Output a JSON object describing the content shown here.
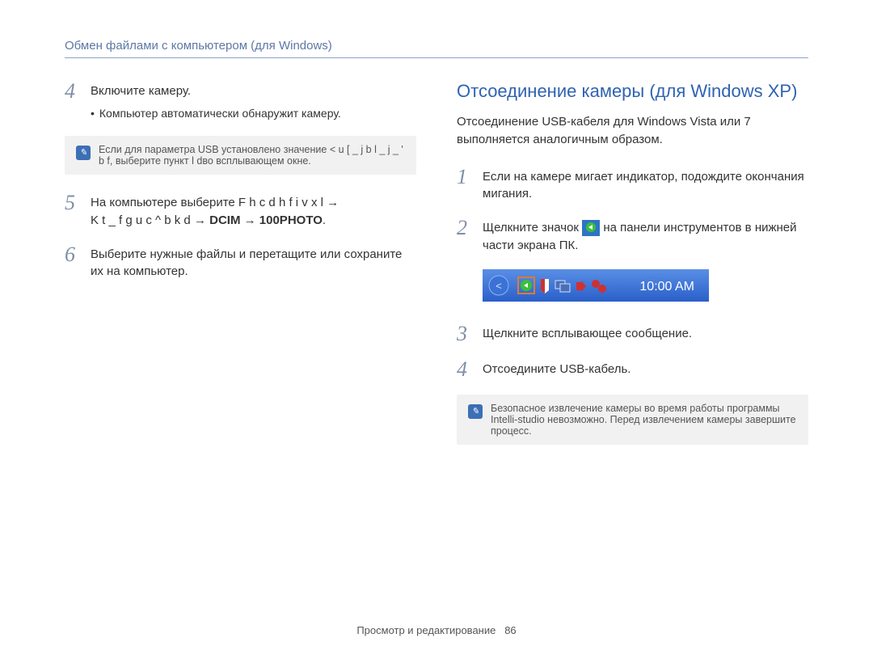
{
  "breadcrumb": "Обмен файлами с компьютером (для Windows)",
  "left": {
    "step4_title": "Включите камеру.",
    "step4_sub": "Компьютер автоматически обнаружит камеру.",
    "note1": "Если для параметра USB установлено значение  < u [ _ j b l _ j _ ' b f, выберите пункт  l dво всплывающем окне.",
    "step5_prefix": "На компьютере выберите  F h c  d h f i v x l  ",
    "step5_line2": "K t _ f g u c ^ b k d",
    "step5_arrow": " → ",
    "step5_b1": "DCIM",
    "step5_b2": "100PHOTO",
    "step6": "Выберите нужные файлы и перетащите или сохраните их на компьютер."
  },
  "right": {
    "title": "Отсоединение камеры (для Windows XP)",
    "intro": "Отсоединение USB-кабеля для Windows Vista или 7 выполняется аналогичным образом.",
    "step1": "Если на камере мигает индикатор, подождите окончания мигания.",
    "step2_a": "Щелкните значок ",
    "step2_b": " на панели инструментов в нижней части экрана ПК.",
    "taskbar_time": "10:00 AM",
    "step3": "Щелкните всплывающее сообщение.",
    "step4": "Отсоедините USB-кабель.",
    "note2": "Безопасное извлечение камеры во время работы программы Intelli-studio невозможно. Перед извлечением камеры завершите процесс."
  },
  "footer": {
    "text": "Просмотр и редактирование",
    "page": "86"
  }
}
